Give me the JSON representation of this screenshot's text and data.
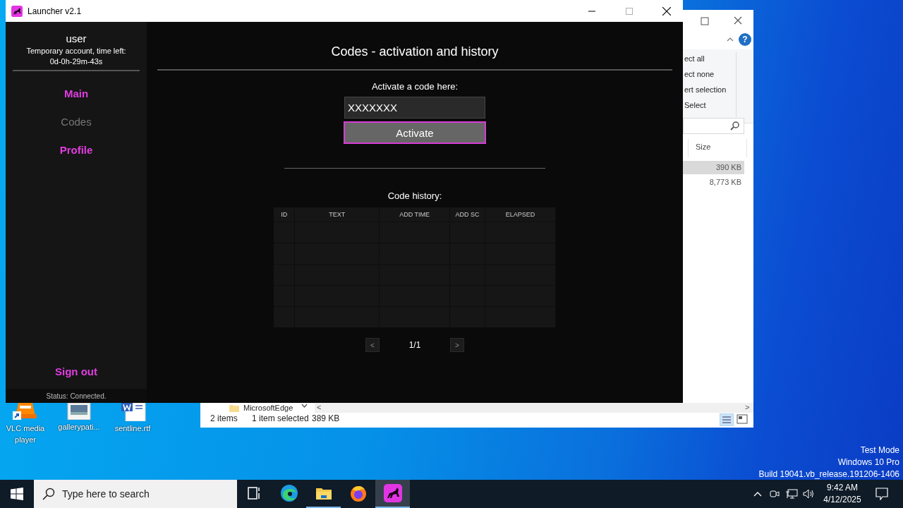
{
  "launcher": {
    "title": "Launcher v2.1",
    "maximize_disabled": true,
    "sidebar": {
      "user": "user",
      "account_note": "Temporary account, time left:",
      "time_left": "0d-0h-29m-43s",
      "nav": [
        {
          "label": "Main",
          "selected": false
        },
        {
          "label": "Codes",
          "selected": true
        },
        {
          "label": "Profile",
          "selected": false
        }
      ],
      "sign_out": "Sign out",
      "status": "Status: Connected."
    },
    "main": {
      "heading": "Codes - activation and history",
      "activate_label": "Activate a code here:",
      "code_field": {
        "value": "XXXXXXX"
      },
      "activate_button": "Activate",
      "history_label": "Code history:",
      "table": {
        "columns": [
          "ID",
          "TEXT",
          "ADD TIME",
          "ADD SC",
          "ELAPSED"
        ]
      },
      "pagination": {
        "prev": "<",
        "page": "1/1",
        "next": ">"
      }
    }
  },
  "explorer": {
    "help": "?",
    "ribbon_items": [
      "ect all",
      "ect none",
      "ert selection",
      "Select"
    ],
    "columns": [
      "Size"
    ],
    "files": [
      {
        "size": "390 KB",
        "selected": true
      },
      {
        "size": "8,773 KB",
        "selected": false
      }
    ],
    "address": "MicrosoftEdge",
    "scroll_left": "<",
    "scroll_right": ">",
    "status": {
      "items": "2 items",
      "selection": "1 item selected",
      "size": "389 KB"
    }
  },
  "desktop_icons": [
    {
      "label": "VLC media player",
      "kind": "vlc"
    },
    {
      "label": "gallerypati...",
      "kind": "image"
    },
    {
      "label": "sentline.rtf",
      "kind": "word"
    }
  ],
  "watermark": [
    "Test Mode",
    "Windows 10 Pro",
    "Build 19041.vb_release.191206-1406"
  ],
  "taskbar": {
    "search_placeholder": "Type here to search",
    "apps": [
      {
        "kind": "taskview",
        "running": false,
        "selected": false
      },
      {
        "kind": "edge",
        "running": false,
        "selected": false
      },
      {
        "kind": "explorer",
        "running": true,
        "selected": false
      },
      {
        "kind": "firefox",
        "running": false,
        "selected": false
      },
      {
        "kind": "launcher",
        "running": true,
        "selected": true
      }
    ],
    "clock": {
      "time": "9:42 AM",
      "date": "4/12/2025"
    }
  }
}
